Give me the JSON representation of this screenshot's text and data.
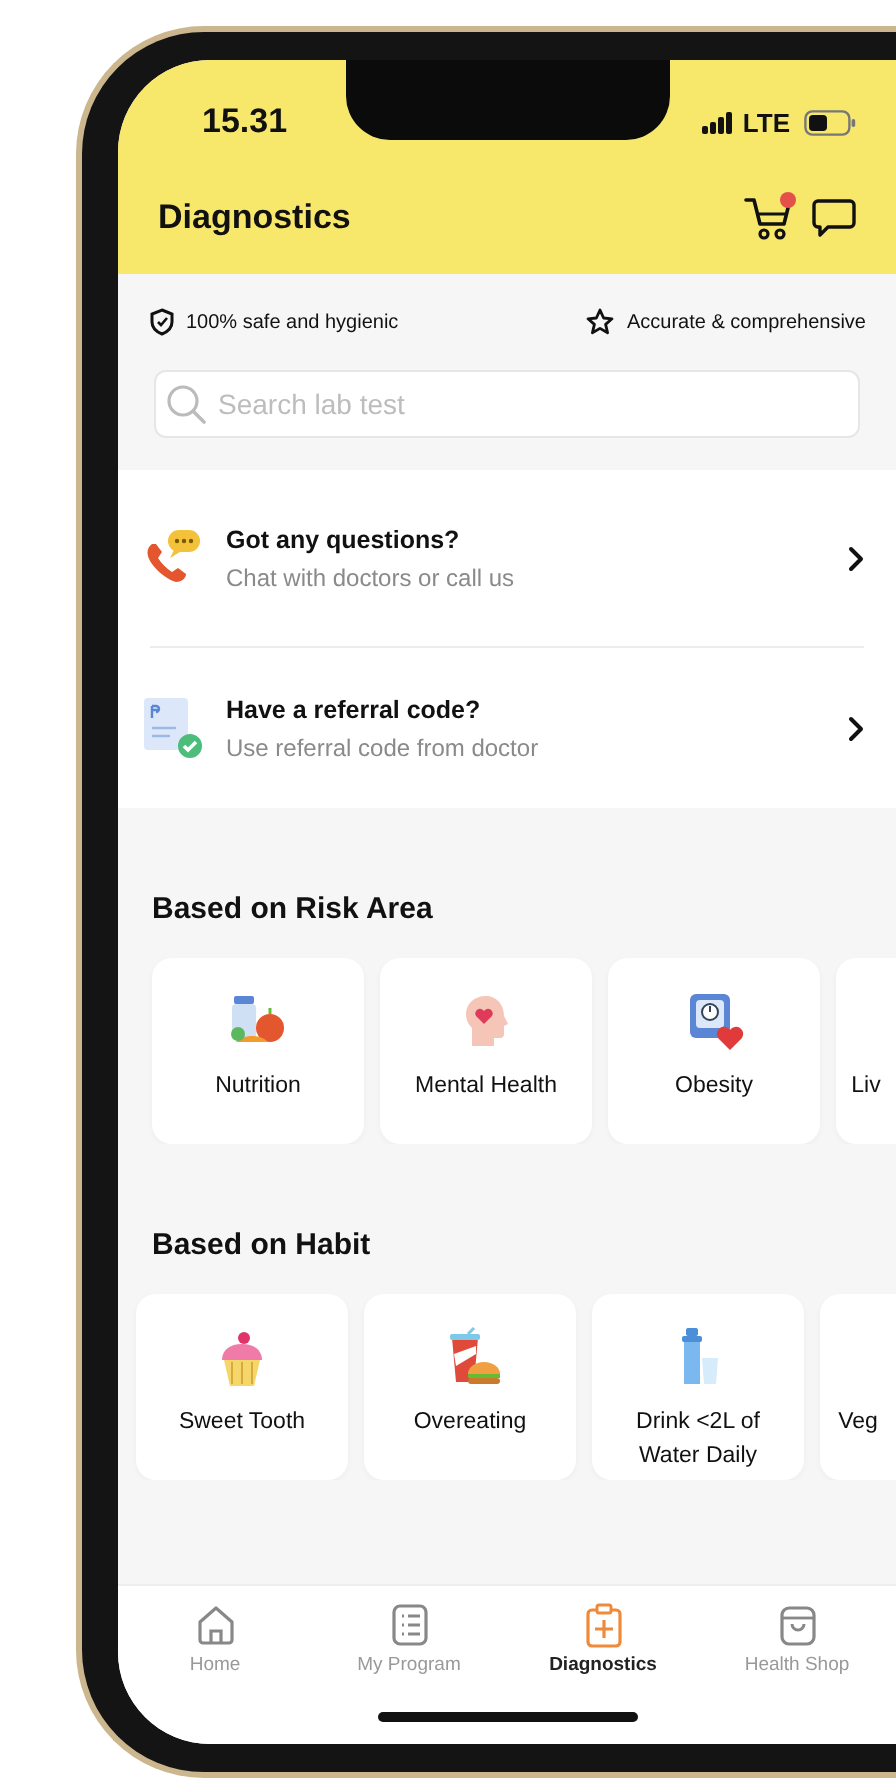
{
  "status_bar": {
    "time": "15.31",
    "network": "LTE"
  },
  "header": {
    "title": "Diagnostics",
    "cart_badge": true
  },
  "trust_badges": [
    {
      "kind": "shield",
      "label": "100% safe and hygienic"
    },
    {
      "kind": "star",
      "label": "Accurate & comprehensive"
    }
  ],
  "search": {
    "placeholder": "Search lab test"
  },
  "help_items": [
    {
      "kind": "call",
      "title": "Got any questions?",
      "subtitle": "Chat with doctors or call us"
    },
    {
      "kind": "referral",
      "title": "Have a referral code?",
      "subtitle": "Use referral code from doctor"
    }
  ],
  "sections": [
    {
      "title": "Based on Risk Area",
      "cards": [
        {
          "kind": "nutrition",
          "label": "Nutrition"
        },
        {
          "kind": "mental",
          "label": "Mental Health"
        },
        {
          "kind": "obesity",
          "label": "Obesity"
        },
        {
          "kind": "partial",
          "label": "Liv"
        }
      ]
    },
    {
      "title": "Based on Habit",
      "cards": [
        {
          "kind": "sweet",
          "label": "Sweet Tooth"
        },
        {
          "kind": "overeating",
          "label": "Overeating"
        },
        {
          "kind": "water",
          "label": "Drink <2L of Water Daily"
        },
        {
          "kind": "partial",
          "label": "Veg"
        }
      ]
    }
  ],
  "bottom_nav": [
    {
      "kind": "home",
      "label": "Home",
      "selected": false
    },
    {
      "kind": "program",
      "label": "My Program",
      "selected": false
    },
    {
      "kind": "diagnostics",
      "label": "Diagnostics",
      "selected": true
    },
    {
      "kind": "shop",
      "label": "Health Shop",
      "selected": false
    }
  ]
}
